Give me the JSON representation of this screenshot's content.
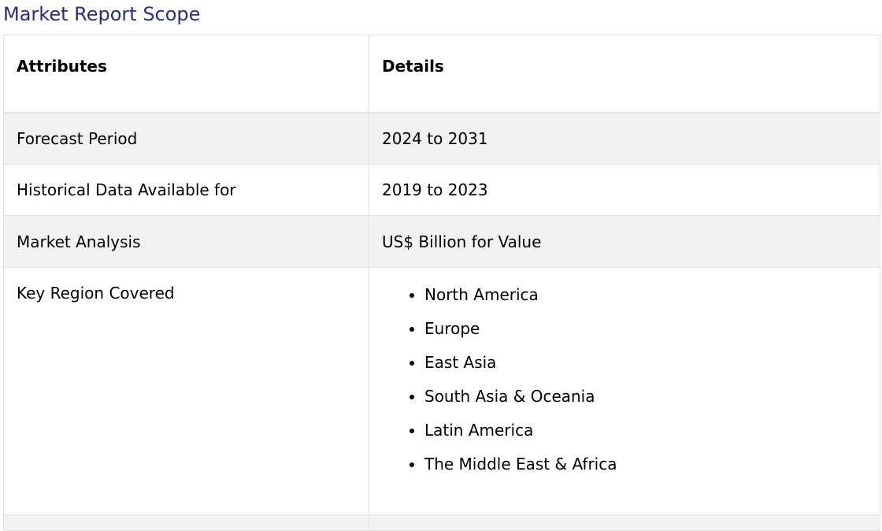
{
  "title": "Market Report Scope",
  "table": {
    "headers": [
      "Attributes",
      "Details"
    ],
    "rows": [
      {
        "attribute": "Forecast Period",
        "detail": "2024 to 2031"
      },
      {
        "attribute": "Historical Data Available for",
        "detail": "2019 to 2023"
      },
      {
        "attribute": "Market Analysis",
        "detail": "US$ Billion for Value"
      },
      {
        "attribute": "Key Region Covered",
        "regions": [
          "North America",
          "Europe",
          "East Asia",
          "South Asia & Oceania",
          "Latin America",
          "The Middle East & Africa"
        ]
      }
    ]
  },
  "colors": {
    "title": "#2b2e7a",
    "row_shade": "#f2f2f2",
    "border": "#e2e2e2"
  }
}
